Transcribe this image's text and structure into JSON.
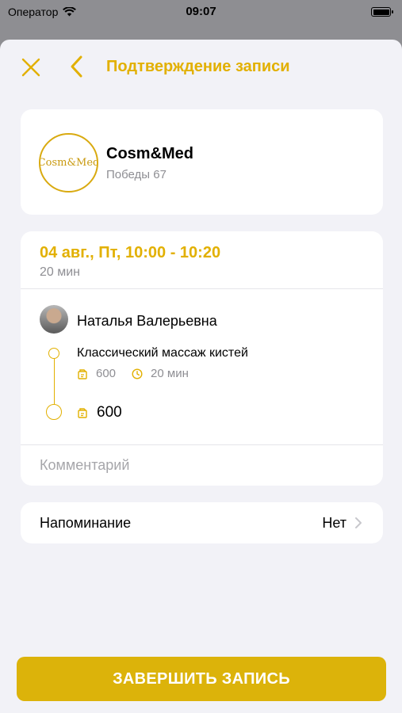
{
  "status_bar": {
    "carrier": "Оператор",
    "time": "09:07"
  },
  "nav": {
    "title": "Подтверждение записи",
    "close_icon": "close-icon",
    "back_icon": "chevron-left-icon"
  },
  "salon": {
    "logo_text": "Cosm&Med",
    "name": "Cosm&Med",
    "address": "Победы 67"
  },
  "booking": {
    "datetime": "04 авг., Пт, 10:00 - 10:20",
    "duration": "20 мин",
    "master_name": "Наталья Валерьевна",
    "service": {
      "name": "Классический массаж кистей",
      "price": "600",
      "duration": "20 мин"
    },
    "total": "600",
    "comment_placeholder": "Комментарий"
  },
  "reminder": {
    "label": "Напоминание",
    "value": "Нет"
  },
  "submit": {
    "label": "ЗАВЕРШИТЬ ЗАПИСЬ"
  },
  "colors": {
    "accent": "#e2b000",
    "button": "#dcb30a",
    "background": "#f2f2f7",
    "secondary_text": "#8e8e93"
  }
}
